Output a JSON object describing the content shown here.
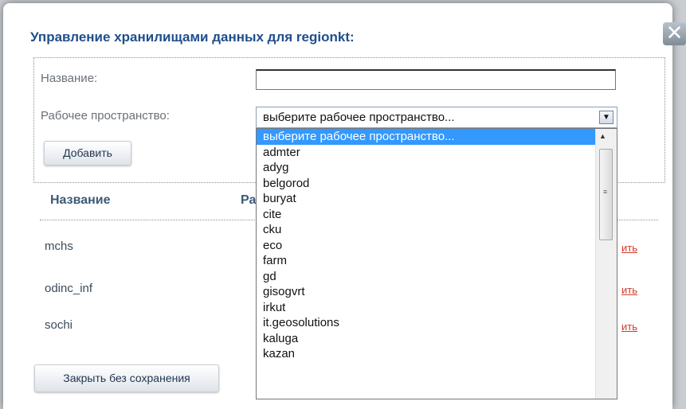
{
  "dialog": {
    "title": "Управление хранилищами данных для regionkt:",
    "close_glyph": "✕"
  },
  "form": {
    "name_label": "Название:",
    "name_value": "",
    "workspace_label": "Рабочее пространство:",
    "workspace_selected": "выберите рабочее пространство...",
    "add_button": "Добавить"
  },
  "table": {
    "headers": [
      "Название",
      "Ра"
    ],
    "rows": [
      {
        "name": "mchs",
        "action": "ить"
      },
      {
        "name": "odinc_inf",
        "action": "ить"
      },
      {
        "name": "sochi",
        "action": "ить"
      }
    ]
  },
  "footer": {
    "close_button": "Закрыть без сохранения"
  },
  "dropdown": {
    "options": [
      "выберите рабочее пространство...",
      "admter",
      "adyg",
      "belgorod",
      "buryat",
      "cite",
      "cku",
      "eco",
      "farm",
      "gd",
      "gisogvrt",
      "irkut",
      "it.geosolutions",
      "kaluga",
      "kazan"
    ],
    "highlighted_index": 0
  },
  "icons": {
    "close": "close-icon",
    "select_arrow": "chevron-down-icon",
    "scroll_up": "scroll-up-arrow-icon",
    "grip": "scroll-grip-icon"
  },
  "colors": {
    "title": "#1f4e8c",
    "selection": "#3399ff",
    "action_link": "#d03a2a"
  }
}
